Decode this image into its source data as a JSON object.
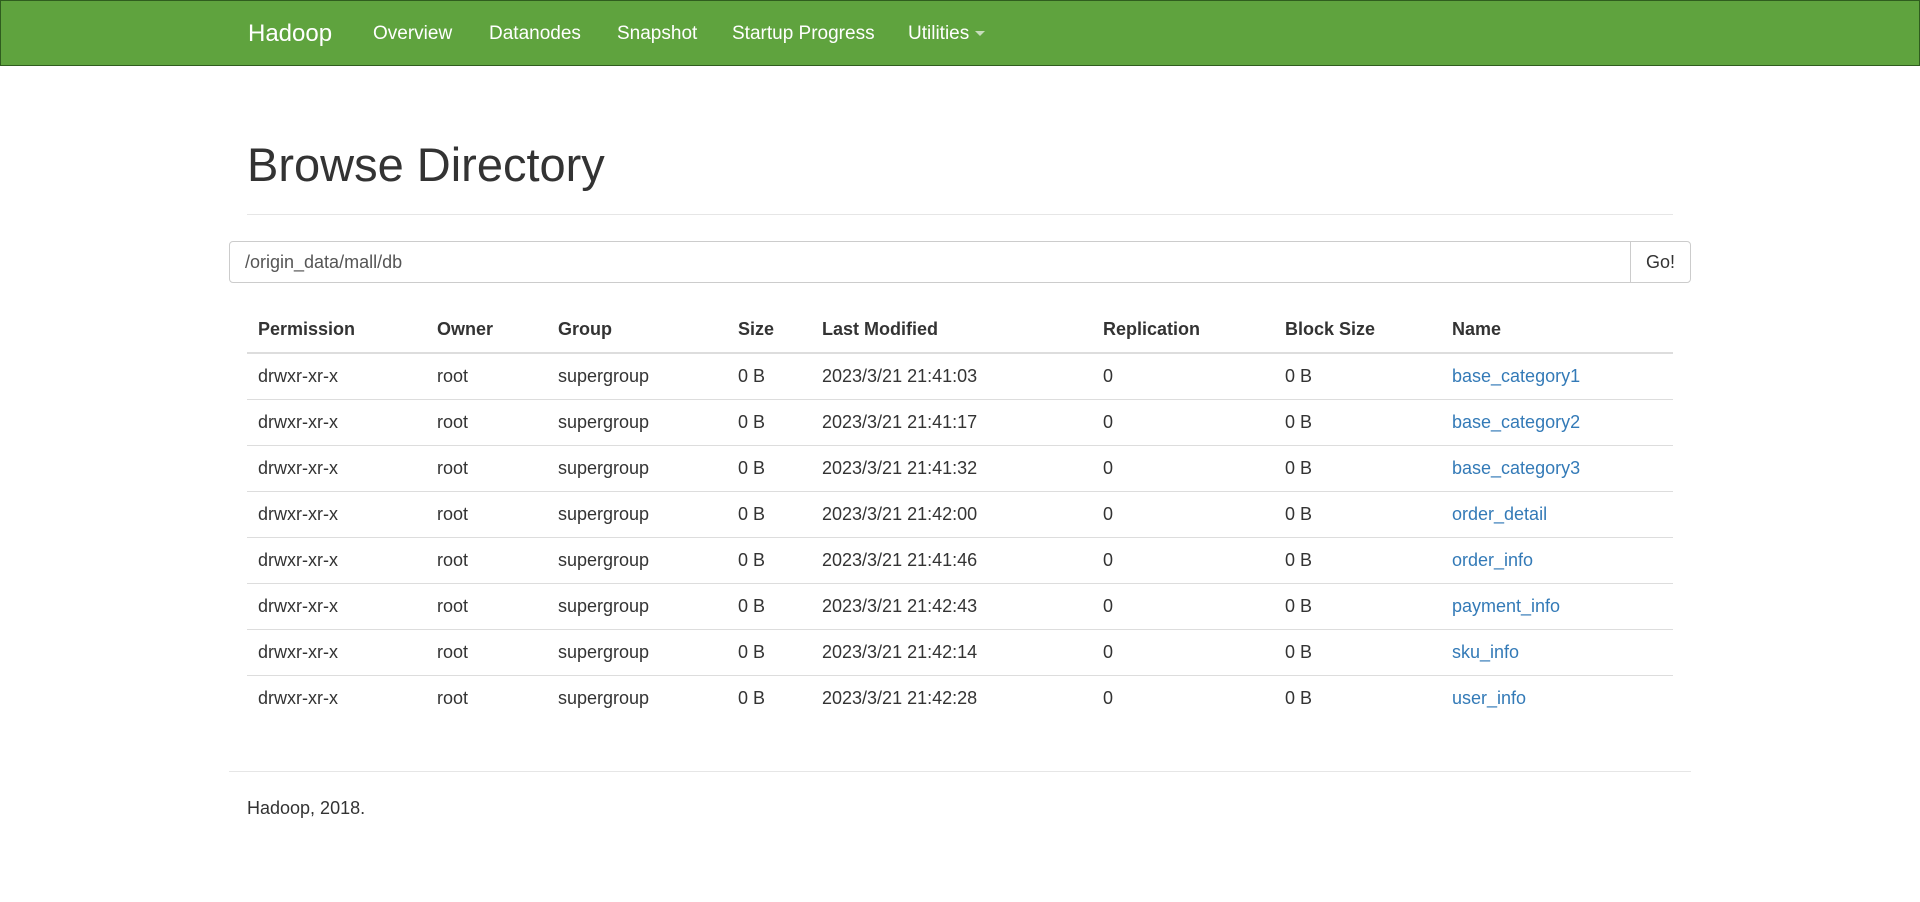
{
  "navbar": {
    "brand": "Hadoop",
    "items": [
      "Overview",
      "Datanodes",
      "Snapshot",
      "Startup Progress",
      "Utilities"
    ],
    "utilities_has_dropdown": true,
    "background": "#5fa33e"
  },
  "header": {
    "title": "Browse Directory"
  },
  "path": {
    "value": "/origin_data/mall/db",
    "go_label": "Go!"
  },
  "table": {
    "columns": [
      "Permission",
      "Owner",
      "Group",
      "Size",
      "Last Modified",
      "Replication",
      "Block Size",
      "Name"
    ],
    "rows": [
      [
        "drwxr-xr-x",
        "root",
        "supergroup",
        "0 B",
        "2023/3/21 21:41:03",
        "0",
        "0 B",
        "base_category1"
      ],
      [
        "drwxr-xr-x",
        "root",
        "supergroup",
        "0 B",
        "2023/3/21 21:41:17",
        "0",
        "0 B",
        "base_category2"
      ],
      [
        "drwxr-xr-x",
        "root",
        "supergroup",
        "0 B",
        "2023/3/21 21:41:32",
        "0",
        "0 B",
        "base_category3"
      ],
      [
        "drwxr-xr-x",
        "root",
        "supergroup",
        "0 B",
        "2023/3/21 21:42:00",
        "0",
        "0 B",
        "order_detail"
      ],
      [
        "drwxr-xr-x",
        "root",
        "supergroup",
        "0 B",
        "2023/3/21 21:41:46",
        "0",
        "0 B",
        "order_info"
      ],
      [
        "drwxr-xr-x",
        "root",
        "supergroup",
        "0 B",
        "2023/3/21 21:42:43",
        "0",
        "0 B",
        "payment_info"
      ],
      [
        "drwxr-xr-x",
        "root",
        "supergroup",
        "0 B",
        "2023/3/21 21:42:14",
        "0",
        "0 B",
        "sku_info"
      ],
      [
        "drwxr-xr-x",
        "root",
        "supergroup",
        "0 B",
        "2023/3/21 21:42:28",
        "0",
        "0 B",
        "user_info"
      ]
    ],
    "link_color": "#337ab7"
  },
  "footer": {
    "text": "Hadoop, 2018."
  }
}
